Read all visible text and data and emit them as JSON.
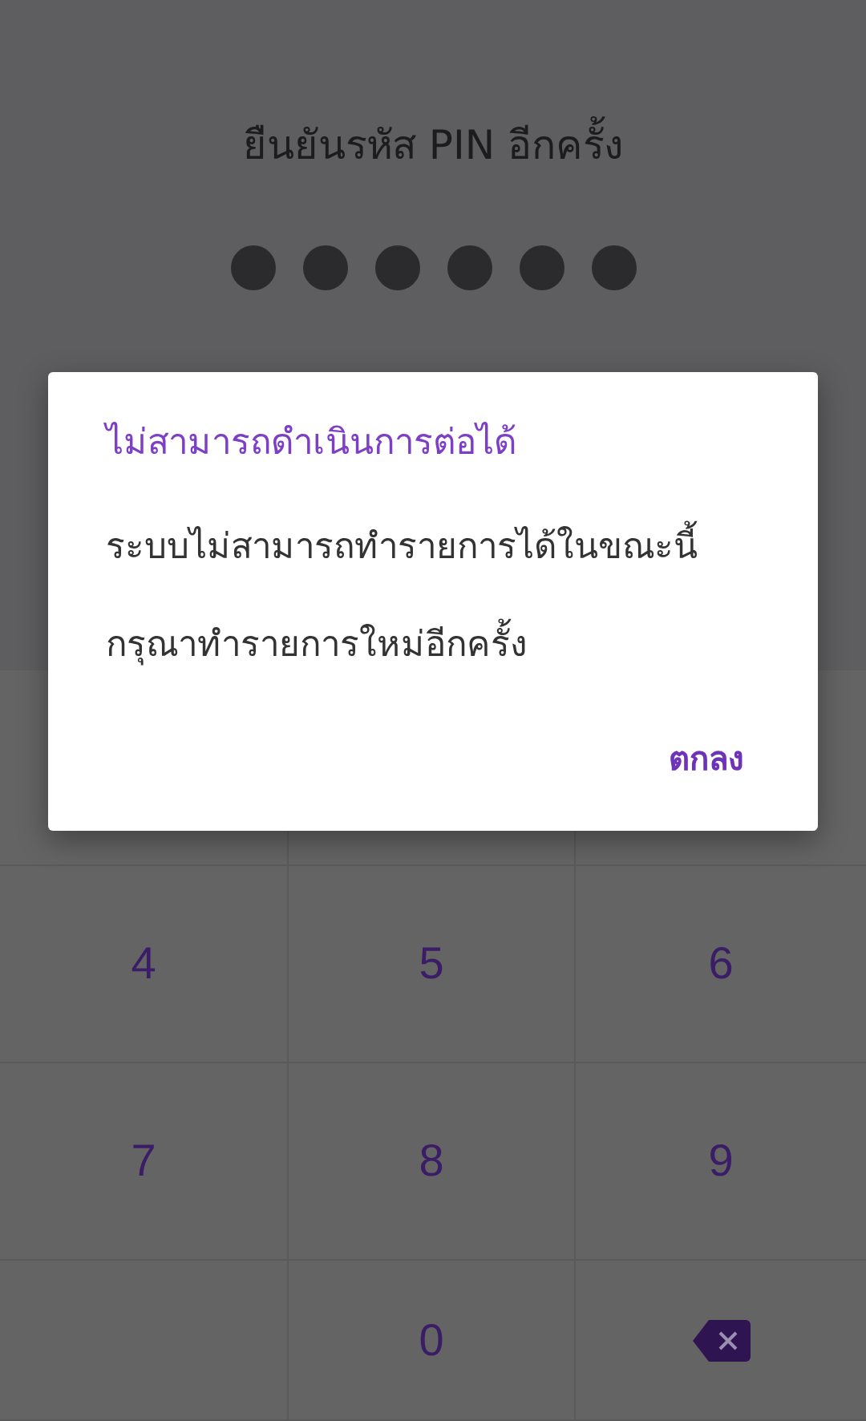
{
  "header": {
    "title": "ยืนยันรหัส PIN อีกครั้ง"
  },
  "pin_dots": [
    {
      "filled": true
    },
    {
      "filled": true
    },
    {
      "filled": true
    },
    {
      "filled": true
    },
    {
      "filled": true
    },
    {
      "filled": true
    }
  ],
  "keypad": [
    {
      "kind": "blank"
    },
    {
      "kind": "blank"
    },
    {
      "kind": "blank"
    },
    {
      "kind": "digit",
      "label": "4"
    },
    {
      "kind": "digit",
      "label": "5"
    },
    {
      "kind": "digit",
      "label": "6"
    },
    {
      "kind": "digit",
      "label": "7"
    },
    {
      "kind": "digit",
      "label": "8"
    },
    {
      "kind": "digit",
      "label": "9"
    },
    {
      "kind": "blank"
    },
    {
      "kind": "digit",
      "label": "0"
    },
    {
      "kind": "backspace"
    }
  ],
  "dialog": {
    "title": "ไม่สามารถดำเนินการต่อได้",
    "message_lines": [
      "ระบบไม่สามารถทำรายการได้ในขณะนี้",
      "กรุณาทำรายการใหม่อีกครั้ง"
    ],
    "button": "ตกลง"
  }
}
